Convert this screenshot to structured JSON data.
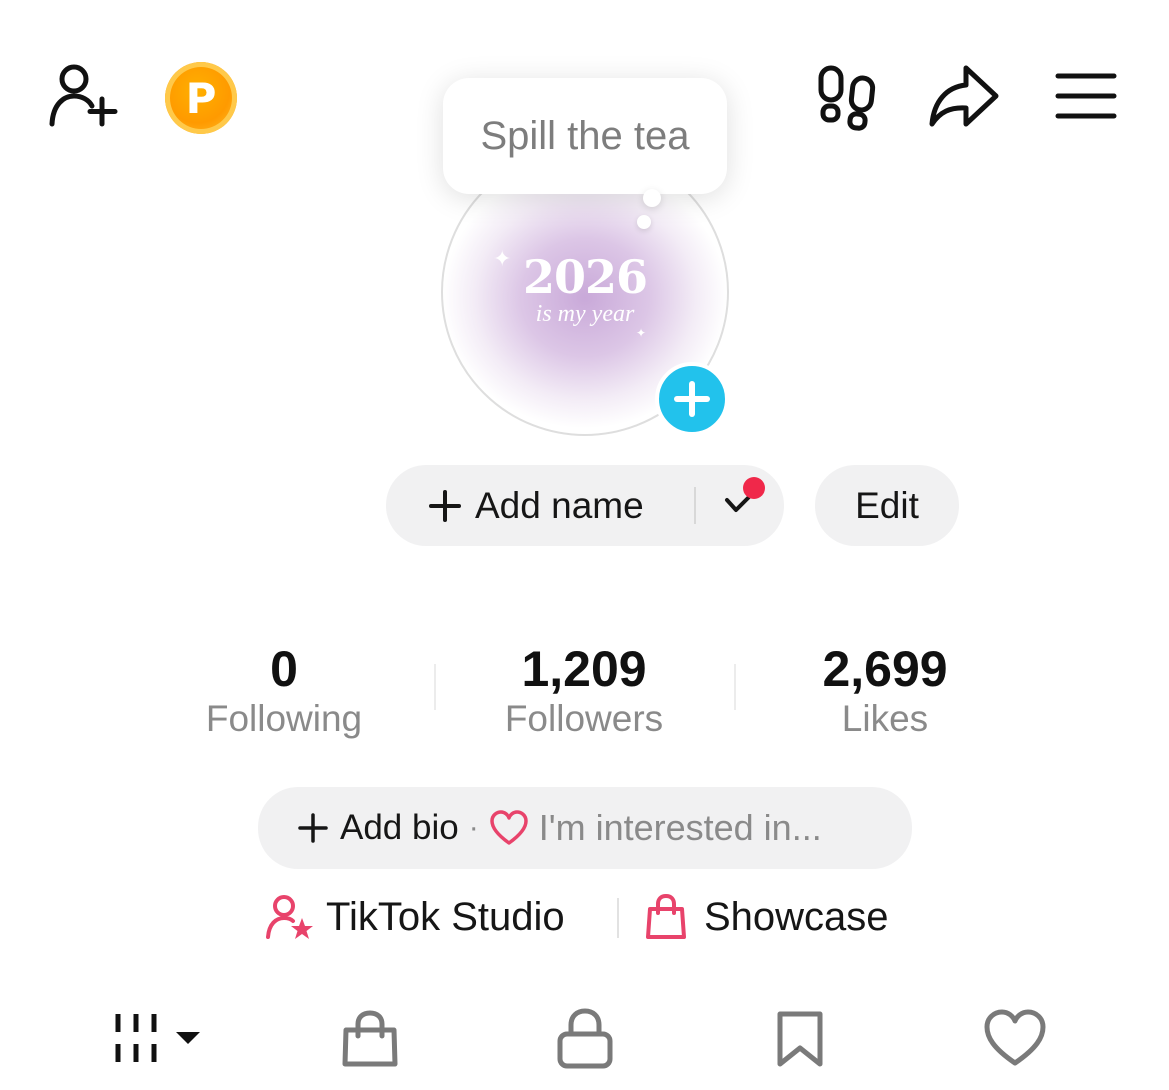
{
  "header": {
    "add_friend_icon": "person-plus-icon",
    "coin_label": "P",
    "footprints_icon": "footprints-icon",
    "share_icon": "share-arrow-icon",
    "menu_icon": "hamburger-menu-icon"
  },
  "avatar": {
    "bubble_text": "Spill the tea",
    "year_text": "2026",
    "subtitle_text": "is my year",
    "add_icon": "plus-icon",
    "badge_color": "#22c2ec"
  },
  "actions": {
    "add_name_label": "Add name",
    "edit_label": "Edit",
    "notification_color": "#f0284a"
  },
  "stats": [
    {
      "value": "0",
      "label": "Following"
    },
    {
      "value": "1,209",
      "label": "Followers"
    },
    {
      "value": "2,699",
      "label": "Likes"
    }
  ],
  "bio": {
    "add_label": "Add bio",
    "separator": "·",
    "interest_label": "I'm interested in..."
  },
  "links": {
    "studio_label": "TikTok Studio",
    "showcase_label": "Showcase",
    "accent_color": "#e8436b"
  },
  "tabs": [
    {
      "icon": "grid-videos-icon",
      "selected": true
    },
    {
      "icon": "shopping-bag-icon",
      "selected": false
    },
    {
      "icon": "lock-icon",
      "selected": false
    },
    {
      "icon": "bookmark-icon",
      "selected": false
    },
    {
      "icon": "heart-icon",
      "selected": false
    }
  ]
}
